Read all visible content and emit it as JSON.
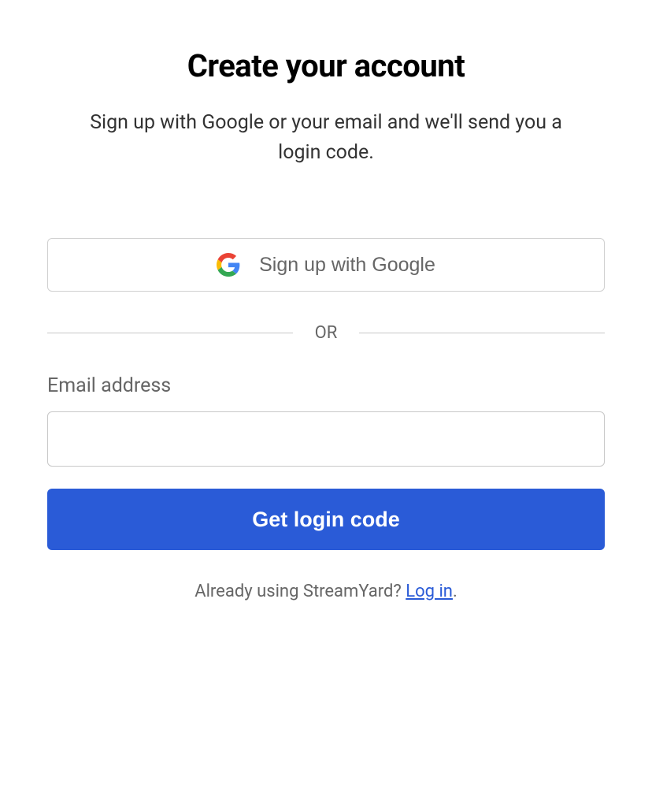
{
  "heading": "Create your account",
  "subheading": "Sign up with Google or your email and we'll send you a login code.",
  "google_button_label": "Sign up with Google",
  "divider_text": "OR",
  "email_label": "Email address",
  "email_value": "",
  "submit_button_label": "Get login code",
  "footer_prompt": "Already using StreamYard? ",
  "login_link_text": "Log in",
  "footer_period": "."
}
